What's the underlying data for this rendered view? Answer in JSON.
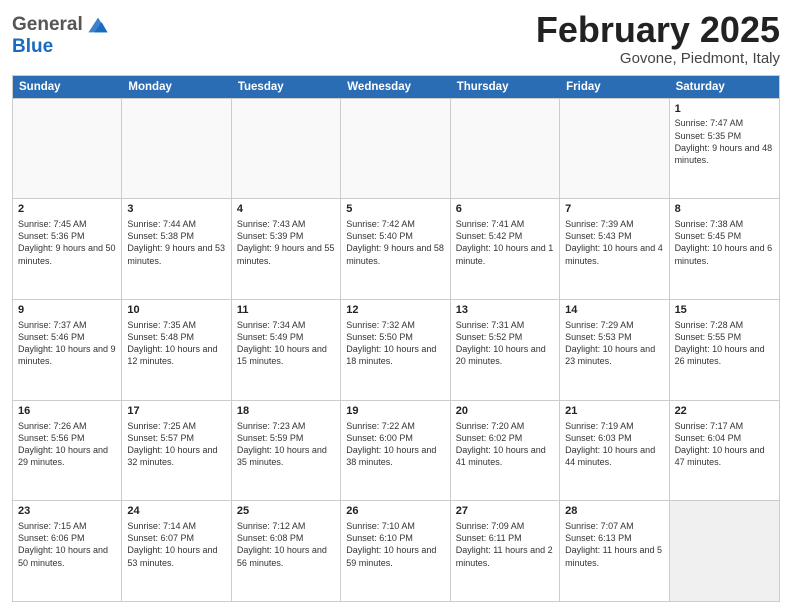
{
  "header": {
    "logo": {
      "line1": "General",
      "line2": "Blue"
    },
    "title": "February 2025",
    "location": "Govone, Piedmont, Italy"
  },
  "calendar": {
    "days": [
      "Sunday",
      "Monday",
      "Tuesday",
      "Wednesday",
      "Thursday",
      "Friday",
      "Saturday"
    ],
    "weeks": [
      [
        {
          "day": "",
          "info": ""
        },
        {
          "day": "",
          "info": ""
        },
        {
          "day": "",
          "info": ""
        },
        {
          "day": "",
          "info": ""
        },
        {
          "day": "",
          "info": ""
        },
        {
          "day": "",
          "info": ""
        },
        {
          "day": "1",
          "info": "Sunrise: 7:47 AM\nSunset: 5:35 PM\nDaylight: 9 hours and 48 minutes."
        }
      ],
      [
        {
          "day": "2",
          "info": "Sunrise: 7:45 AM\nSunset: 5:36 PM\nDaylight: 9 hours and 50 minutes."
        },
        {
          "day": "3",
          "info": "Sunrise: 7:44 AM\nSunset: 5:38 PM\nDaylight: 9 hours and 53 minutes."
        },
        {
          "day": "4",
          "info": "Sunrise: 7:43 AM\nSunset: 5:39 PM\nDaylight: 9 hours and 55 minutes."
        },
        {
          "day": "5",
          "info": "Sunrise: 7:42 AM\nSunset: 5:40 PM\nDaylight: 9 hours and 58 minutes."
        },
        {
          "day": "6",
          "info": "Sunrise: 7:41 AM\nSunset: 5:42 PM\nDaylight: 10 hours and 1 minute."
        },
        {
          "day": "7",
          "info": "Sunrise: 7:39 AM\nSunset: 5:43 PM\nDaylight: 10 hours and 4 minutes."
        },
        {
          "day": "8",
          "info": "Sunrise: 7:38 AM\nSunset: 5:45 PM\nDaylight: 10 hours and 6 minutes."
        }
      ],
      [
        {
          "day": "9",
          "info": "Sunrise: 7:37 AM\nSunset: 5:46 PM\nDaylight: 10 hours and 9 minutes."
        },
        {
          "day": "10",
          "info": "Sunrise: 7:35 AM\nSunset: 5:48 PM\nDaylight: 10 hours and 12 minutes."
        },
        {
          "day": "11",
          "info": "Sunrise: 7:34 AM\nSunset: 5:49 PM\nDaylight: 10 hours and 15 minutes."
        },
        {
          "day": "12",
          "info": "Sunrise: 7:32 AM\nSunset: 5:50 PM\nDaylight: 10 hours and 18 minutes."
        },
        {
          "day": "13",
          "info": "Sunrise: 7:31 AM\nSunset: 5:52 PM\nDaylight: 10 hours and 20 minutes."
        },
        {
          "day": "14",
          "info": "Sunrise: 7:29 AM\nSunset: 5:53 PM\nDaylight: 10 hours and 23 minutes."
        },
        {
          "day": "15",
          "info": "Sunrise: 7:28 AM\nSunset: 5:55 PM\nDaylight: 10 hours and 26 minutes."
        }
      ],
      [
        {
          "day": "16",
          "info": "Sunrise: 7:26 AM\nSunset: 5:56 PM\nDaylight: 10 hours and 29 minutes."
        },
        {
          "day": "17",
          "info": "Sunrise: 7:25 AM\nSunset: 5:57 PM\nDaylight: 10 hours and 32 minutes."
        },
        {
          "day": "18",
          "info": "Sunrise: 7:23 AM\nSunset: 5:59 PM\nDaylight: 10 hours and 35 minutes."
        },
        {
          "day": "19",
          "info": "Sunrise: 7:22 AM\nSunset: 6:00 PM\nDaylight: 10 hours and 38 minutes."
        },
        {
          "day": "20",
          "info": "Sunrise: 7:20 AM\nSunset: 6:02 PM\nDaylight: 10 hours and 41 minutes."
        },
        {
          "day": "21",
          "info": "Sunrise: 7:19 AM\nSunset: 6:03 PM\nDaylight: 10 hours and 44 minutes."
        },
        {
          "day": "22",
          "info": "Sunrise: 7:17 AM\nSunset: 6:04 PM\nDaylight: 10 hours and 47 minutes."
        }
      ],
      [
        {
          "day": "23",
          "info": "Sunrise: 7:15 AM\nSunset: 6:06 PM\nDaylight: 10 hours and 50 minutes."
        },
        {
          "day": "24",
          "info": "Sunrise: 7:14 AM\nSunset: 6:07 PM\nDaylight: 10 hours and 53 minutes."
        },
        {
          "day": "25",
          "info": "Sunrise: 7:12 AM\nSunset: 6:08 PM\nDaylight: 10 hours and 56 minutes."
        },
        {
          "day": "26",
          "info": "Sunrise: 7:10 AM\nSunset: 6:10 PM\nDaylight: 10 hours and 59 minutes."
        },
        {
          "day": "27",
          "info": "Sunrise: 7:09 AM\nSunset: 6:11 PM\nDaylight: 11 hours and 2 minutes."
        },
        {
          "day": "28",
          "info": "Sunrise: 7:07 AM\nSunset: 6:13 PM\nDaylight: 11 hours and 5 minutes."
        },
        {
          "day": "",
          "info": ""
        }
      ]
    ]
  }
}
